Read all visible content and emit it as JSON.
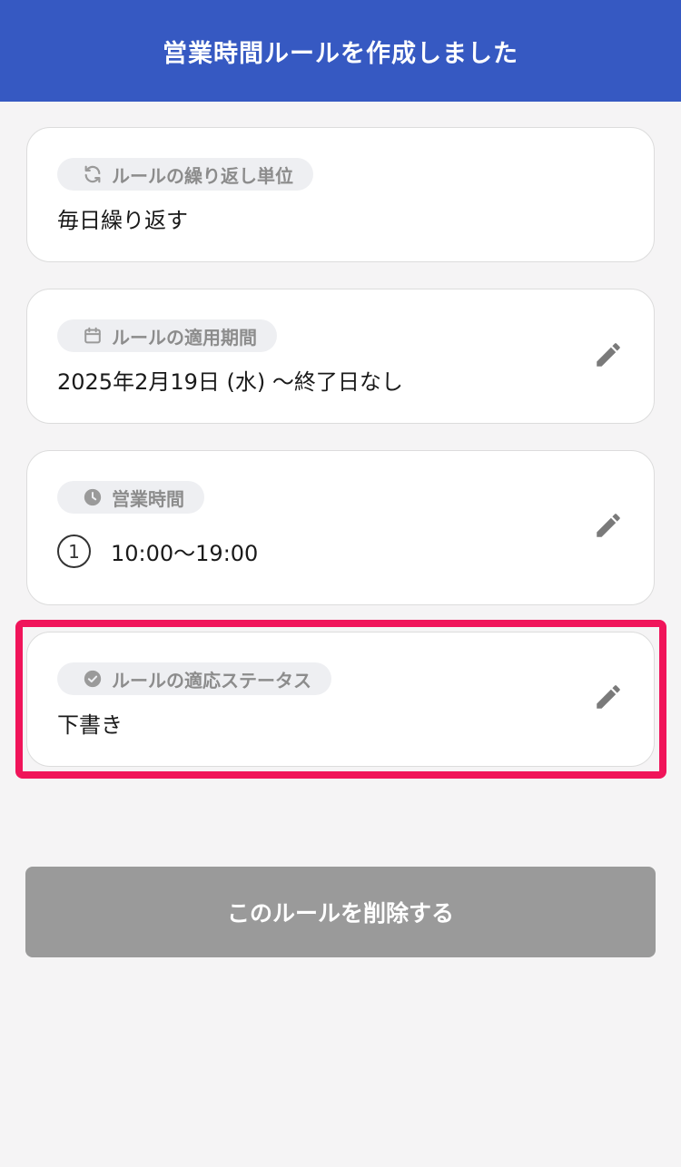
{
  "header": {
    "title": "営業時間ルールを作成しました"
  },
  "repeat": {
    "label": "ルールの繰り返し単位",
    "value": "毎日繰り返す",
    "icon": "refresh-icon"
  },
  "period": {
    "label": "ルールの適用期間",
    "value": "2025年2月19日 (水) 〜終了日なし",
    "icon": "calendar-icon"
  },
  "hours": {
    "label": "営業時間",
    "index": "1",
    "value": "10:00〜19:00",
    "icon": "clock-icon"
  },
  "status": {
    "label": "ルールの適応ステータス",
    "value": "下書き",
    "icon": "check-circle-icon"
  },
  "actions": {
    "delete_label": "このルールを削除する"
  },
  "colors": {
    "header": "#3659c2",
    "highlight": "#f0145a",
    "delete_button": "#9a9a9a"
  }
}
